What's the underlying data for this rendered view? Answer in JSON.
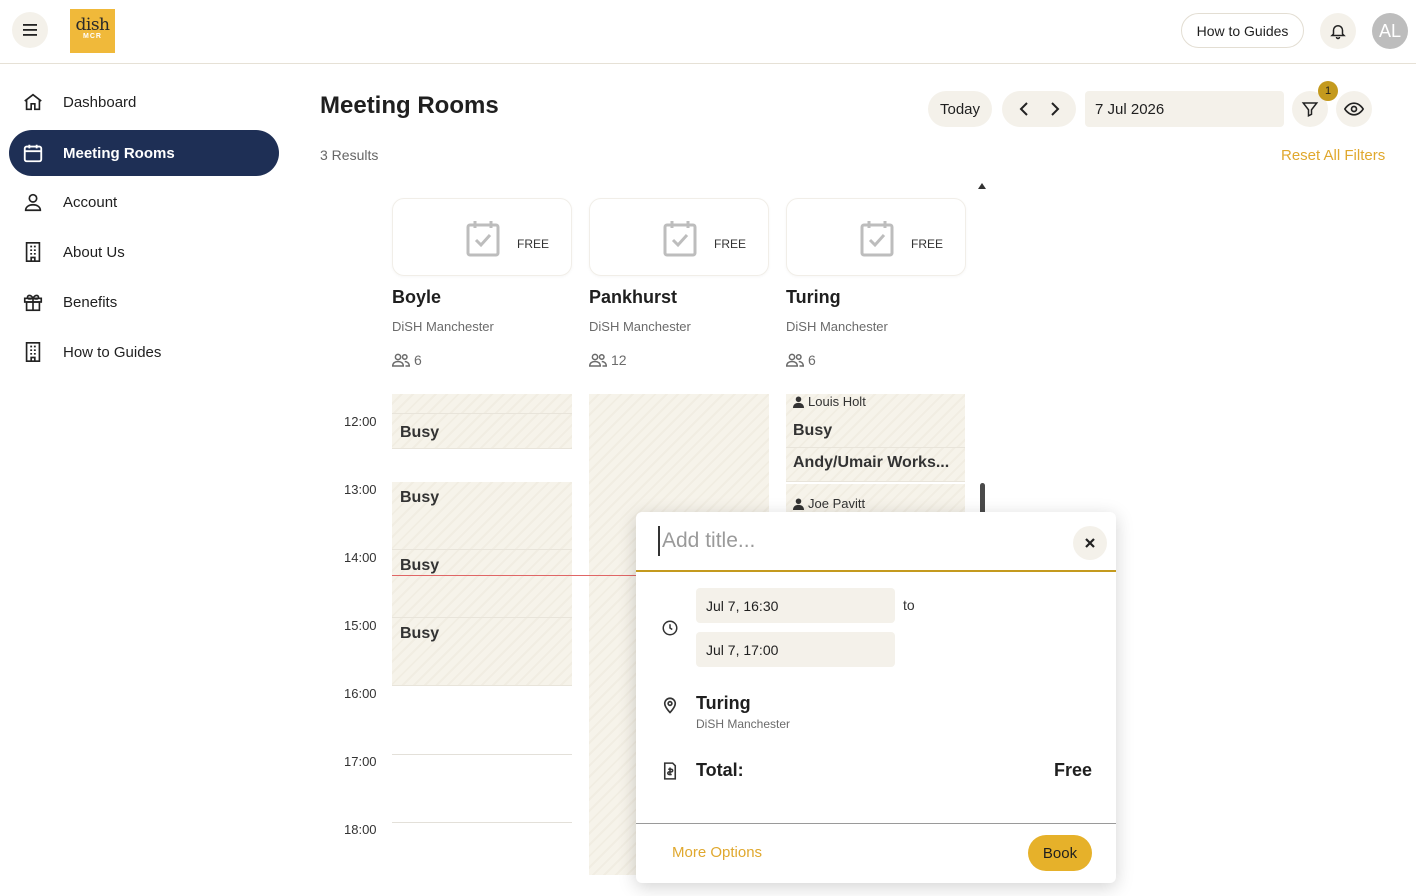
{
  "header": {
    "logo_text": "dish",
    "logo_sub": "MCR",
    "guides_button": "How to Guides",
    "avatar_initials": "AL"
  },
  "sidebar": {
    "items": [
      {
        "label": "Dashboard",
        "icon": "home-icon",
        "active": false
      },
      {
        "label": "Meeting Rooms",
        "icon": "calendar-icon",
        "active": true
      },
      {
        "label": "Account",
        "icon": "user-icon",
        "active": false
      },
      {
        "label": "About Us",
        "icon": "building-icon",
        "active": false
      },
      {
        "label": "Benefits",
        "icon": "gift-icon",
        "active": false
      },
      {
        "label": "How to Guides",
        "icon": "building-icon",
        "active": false
      }
    ]
  },
  "main": {
    "title": "Meeting Rooms",
    "results": "3 Results",
    "reset_filters": "Reset All Filters",
    "today_button": "Today",
    "date": "7 Jul 2026",
    "filter_count": "1"
  },
  "rooms": [
    {
      "status": "FREE",
      "name": "Boyle",
      "location": "DiSH Manchester",
      "capacity": "6"
    },
    {
      "status": "FREE",
      "name": "Pankhurst",
      "location": "DiSH Manchester",
      "capacity": "12"
    },
    {
      "status": "FREE",
      "name": "Turing",
      "location": "DiSH Manchester",
      "capacity": "6"
    }
  ],
  "timeline": {
    "hours": [
      "12:00",
      "13:00",
      "14:00",
      "15:00",
      "16:00",
      "17:00",
      "18:00"
    ]
  },
  "events": {
    "boyle": [
      "Busy",
      "Busy",
      "Busy",
      "Busy"
    ],
    "turing": {
      "organizer_1": "Louis Holt",
      "event_1": "Busy",
      "event_2": "Andy/Umair Works...",
      "organizer_2": "Joe Pavitt"
    }
  },
  "booking_popup": {
    "title_placeholder": "Add title...",
    "start": "Jul 7, 16:30",
    "to_label": "to",
    "end": "Jul 7, 17:00",
    "room": "Turing",
    "location": "DiSH Manchester",
    "total_label": "Total:",
    "total_value": "Free",
    "more_options": "More Options",
    "book_button": "Book"
  },
  "colors": {
    "accent": "#e0a82e",
    "nav_active": "#1e2f55",
    "button_bg": "#f4f1ea",
    "now_line": "#e06666"
  }
}
